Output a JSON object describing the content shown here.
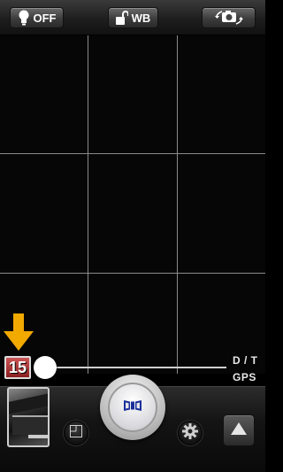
{
  "topbar": {
    "flash_label": "OFF",
    "flash_icon": "bulb-icon",
    "wb_label": "WB",
    "wb_icon": "unlock-icon",
    "flip_icon": "camera-switch-icon"
  },
  "viewfinder": {
    "grid": "3x3"
  },
  "overlay": {
    "timer_value": "15",
    "arrow_color": "#f2a900",
    "zoom_level": 0,
    "dt_label": "D / T",
    "gps_label": "GPS"
  },
  "bottombar": {
    "mode_icon": "square-mode-icon",
    "shutter_icon": "panorama-icon",
    "shutter_accent": "#1a2f9a",
    "settings_icon": "gear-icon",
    "expand_icon": "triangle-up-icon"
  }
}
